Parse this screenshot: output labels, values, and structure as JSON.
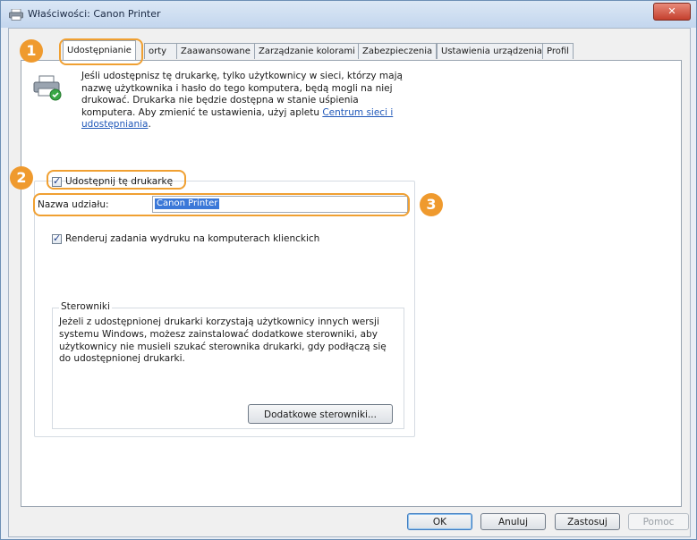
{
  "window": {
    "title": "Właściwości: Canon Printer",
    "close_label": "✕"
  },
  "tabs": [
    {
      "label": "Udostępnianie"
    },
    {
      "label": "orty"
    },
    {
      "label": "Zaawansowane"
    },
    {
      "label": "Zarządzanie kolorami"
    },
    {
      "label": "Zabezpieczenia"
    },
    {
      "label": "Ustawienia urządzenia"
    },
    {
      "label": "Profil"
    }
  ],
  "info": {
    "text": "Jeśli udostępnisz tę drukarkę, tylko użytkownicy w sieci, którzy mają nazwę użytkownika i hasło do tego komputera, będą mogli na niej drukować. Drukarka nie będzie dostępna w stanie uśpienia komputera. Aby zmienić te ustawienia, użyj apletu ",
    "link": "Centrum sieci i udostępniania",
    "end": "."
  },
  "share": {
    "checkbox_label": "Udostępnij tę drukarkę",
    "checked": true,
    "name_label": "Nazwa udziału:",
    "name_value": "Canon Printer",
    "render_label": "Renderuj zadania wydruku na komputerach klienckich",
    "render_checked": true
  },
  "drivers": {
    "legend": "Sterowniki",
    "text": "Jeżeli z udostępnionej drukarki korzystają użytkownicy innych wersji systemu Windows, możesz zainstalować dodatkowe sterowniki, aby użytkownicy nie musieli szukać sterownika drukarki, gdy podłączą się do udostępnionej drukarki.",
    "button": "Dodatkowe sterowniki..."
  },
  "buttons": {
    "ok": "OK",
    "cancel": "Anuluj",
    "apply": "Zastosuj",
    "help": "Pomoc"
  },
  "annotations": {
    "badge1": "1",
    "badge2": "2",
    "badge3": "3"
  },
  "colors": {
    "accent": "#ef9a2e",
    "selection": "#3b78d8",
    "link": "#1f57b8"
  }
}
